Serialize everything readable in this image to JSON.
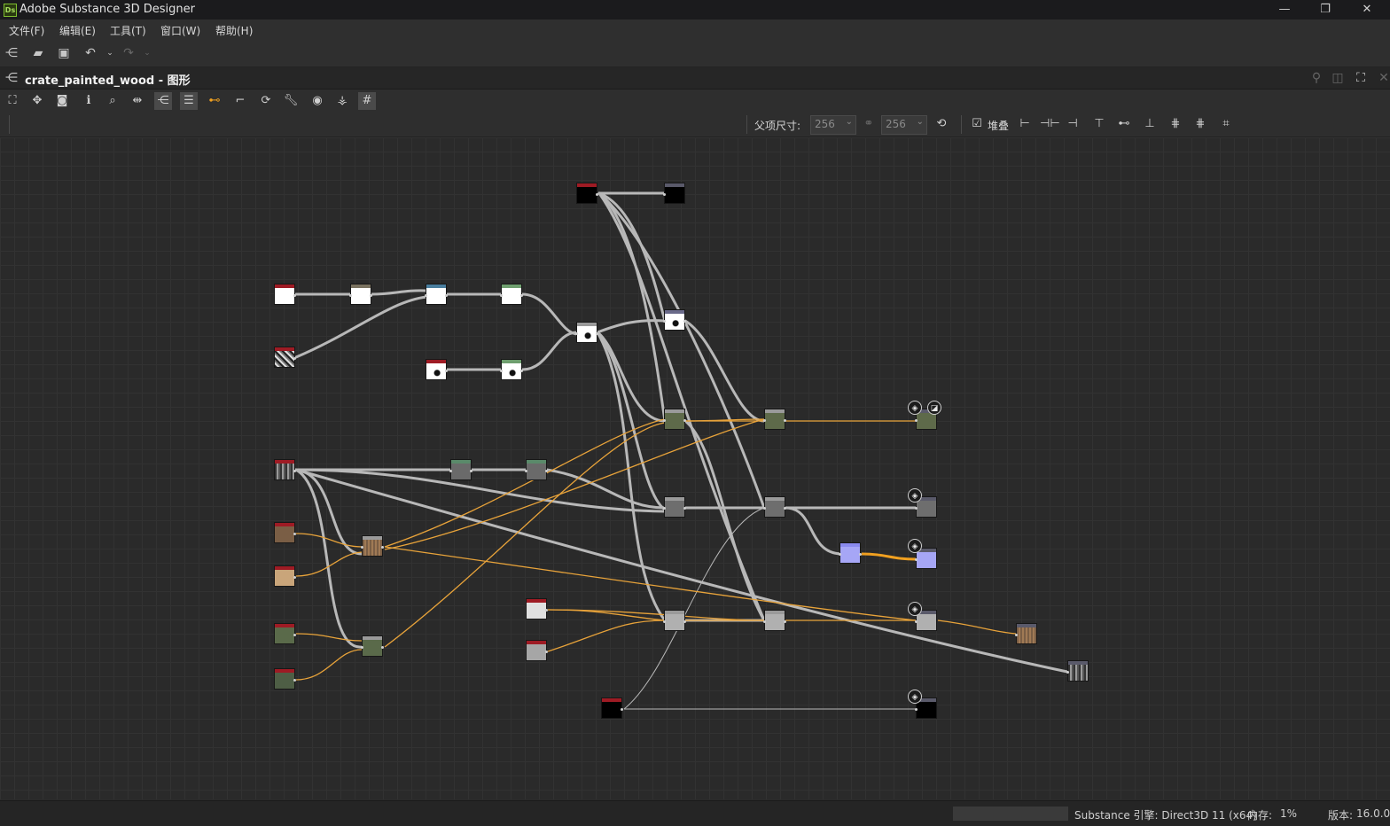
{
  "app": {
    "title": "Adobe Substance 3D Designer",
    "logo_text": "Ds",
    "window_controls": [
      "minimize-icon",
      "restore-icon",
      "close-icon"
    ]
  },
  "menu": [
    "文件(F)",
    "编辑(E)",
    "工具(T)",
    "窗口(W)",
    "帮助(H)"
  ],
  "main_toolbar": [
    "new-graph-icon",
    "open-folder-icon",
    "save-icon",
    "undo-icon",
    "redo-icon"
  ],
  "document": {
    "title": "crate_painted_wood - 图形"
  },
  "graph_toolbar": {
    "size_label": "父项尺寸:",
    "width_value": "256",
    "height_value": "256",
    "stack_label": "堆叠",
    "stack_checked": true
  },
  "colors": {
    "wire_gray": "#b8b8b8",
    "wire_orange": "#e8a33a",
    "node_header_red": "#9e1b24",
    "output_header": "#5a5a6a"
  },
  "status": {
    "engine": "Substance 引擎: Direct3D 11 (x64)",
    "memory_label": "内存:",
    "memory_value": "1%",
    "version_label": "版本:",
    "version_value": "16.0.0"
  }
}
